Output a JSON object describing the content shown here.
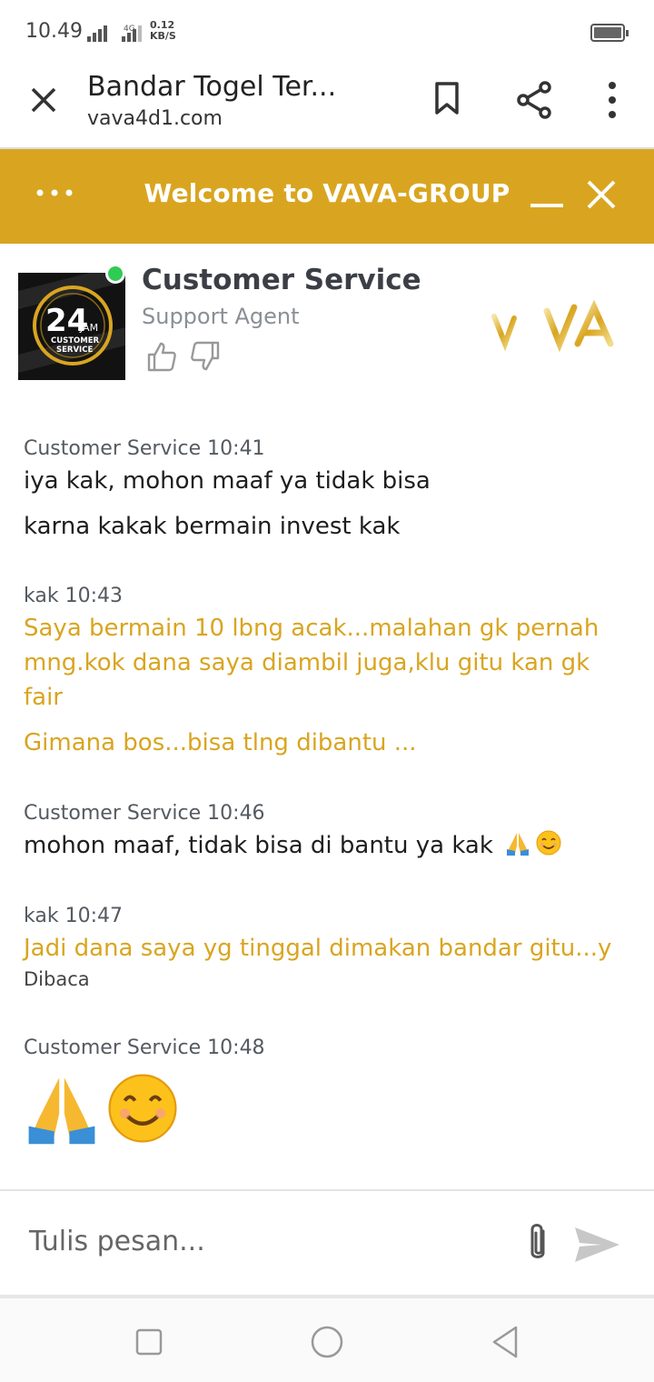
{
  "status_bar": {
    "time": "10.49",
    "network": "4G",
    "speed_value": "0.12",
    "speed_unit": "KB/S"
  },
  "browser": {
    "title": "Bandar Togel Ter...",
    "url": "vava4d1.com"
  },
  "chat_header": {
    "title": "Welcome to VAVA-GROUP"
  },
  "agent": {
    "name": "Customer Service",
    "role": "Support Agent",
    "avatar_text_big": "24",
    "avatar_text_jam": "JAM",
    "avatar_text_line1": "CUSTOMER",
    "avatar_text_line2": "SERVICE",
    "status_color": "#2ecc54",
    "brand_logo": "VAVA"
  },
  "messages": [
    {
      "meta": "Customer Service 10:41",
      "lines": [
        "iya kak, mohon maaf ya tidak bisa",
        "karna kakak bermain invest kak"
      ]
    },
    {
      "meta": "kak 10:43",
      "lines": [
        "Saya bermain 10 lbng acak...malahan gk pernah mng.kok dana saya diambil juga,klu gitu kan gk fair",
        "Gimana bos...bisa tlng dibantu ..."
      ]
    },
    {
      "meta": "Customer Service 10:46",
      "lines": [
        "mohon maaf, tidak bisa di bantu ya kak"
      ]
    },
    {
      "meta": "kak 10:47",
      "lines": [
        "Jadi dana saya yg tinggal dimakan bandar gitu...y"
      ],
      "read_status": "Dibaca"
    },
    {
      "meta": "Customer Service 10:48",
      "lines": []
    }
  ],
  "input": {
    "placeholder": "Tulis pesan..."
  },
  "colors": {
    "accent": "#d9a520",
    "user_text": "#d9a520"
  }
}
